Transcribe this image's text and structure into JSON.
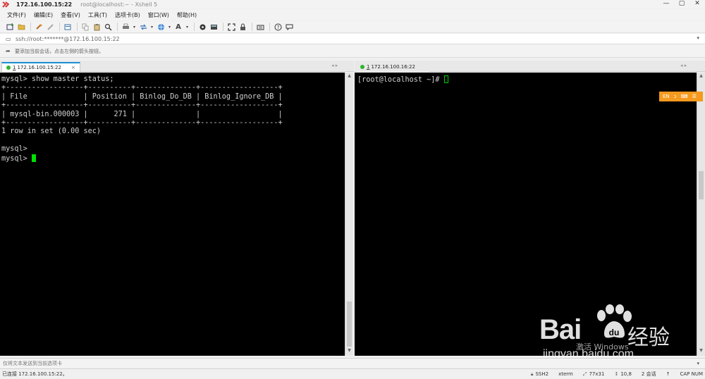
{
  "window": {
    "host": "172.16.100.15:22",
    "subtitle": "root@localhost:~ - Xshell 5",
    "controls": [
      "—",
      "▢",
      "✕"
    ]
  },
  "menu": [
    "文件(F)",
    "编辑(E)",
    "查看(V)",
    "工具(T)",
    "选项卡(B)",
    "窗口(W)",
    "帮助(H)"
  ],
  "toolbar_icons": [
    "new-session-icon",
    "open-folder-icon",
    "reconnect-icon",
    "disconnect-icon",
    "properties-icon",
    "copy-icon",
    "paste-icon",
    "find-icon",
    "print-icon",
    "transfer-icon",
    "web-icon",
    "font-icon",
    "script-icon",
    "compose-icon",
    "fullscreen-icon",
    "lock-icon",
    "keyboard-icon",
    "help-icon",
    "chat-icon"
  ],
  "address": {
    "text": "ssh://root:*******@172.16.100.15:22"
  },
  "hint": {
    "text": "要添加当前会话，点击左侧的箭头按钮。"
  },
  "left_pane": {
    "tab": {
      "num": "1",
      "host": "172.16.100.15:22",
      "close": "×"
    },
    "nav": "◂ ▸",
    "lines": [
      "mysql> show master status;",
      "+------------------+----------+--------------+------------------+",
      "| File             | Position | Binlog_Do_DB | Binlog_Ignore_DB |",
      "+------------------+----------+--------------+------------------+",
      "| mysql-bin.000003 |      271 |              |                  |",
      "+------------------+----------+--------------+------------------+",
      "1 row in set (0.00 sec)",
      "",
      "mysql>",
      "mysql> "
    ]
  },
  "right_pane": {
    "tab": {
      "num": "1",
      "host": "172.16.100.16:22",
      "close": ""
    },
    "nav": "◂ ▸",
    "prompt": "[root@localhost ~]# "
  },
  "lang_widget": {
    "label": "EN",
    "extra": "⌨"
  },
  "sendbar": {
    "text": "仅将文本发送到当前选项卡"
  },
  "status": {
    "connection": "已连接 172.16.100.15:22。",
    "protocol": "SSH2",
    "term": "xterm",
    "size": "77x31",
    "pos": "10,8",
    "sessions": "2 会话",
    "caps": "CAP NUM"
  },
  "watermark": {
    "brand": "Bai",
    "jingyan": "经验",
    "url": "jingyan.baidu.com",
    "windows_activate": "激活 Windows"
  },
  "colors": {
    "terminal_bg": "#000000",
    "terminal_fg": "#d0d0d0",
    "cursor": "#00e000",
    "tab_accent": "#1b8fd2",
    "lang_widget": "#f59a1e"
  }
}
